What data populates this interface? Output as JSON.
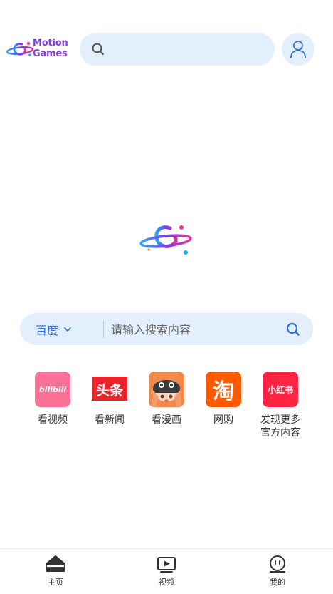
{
  "header": {
    "brand_line1": "Motion",
    "brand_line2": "Games",
    "search_placeholder": "",
    "icons": {
      "search": "search-icon",
      "profile": "user-icon"
    }
  },
  "search": {
    "engine": "百度",
    "placeholder": "请输入搜索内容",
    "value": "",
    "icons": {
      "dropdown": "chevron-down-icon",
      "go": "search-icon"
    }
  },
  "shortcuts": [
    {
      "label": "看视频",
      "tile_text": "bilibili",
      "color": "#fb7299"
    },
    {
      "label": "看新闻",
      "tile_text": "头条",
      "color": "#e8232a"
    },
    {
      "label": "看漫画",
      "tile_text": "",
      "color": "#f08a4b"
    },
    {
      "label": "网购",
      "tile_text": "淘",
      "color": "#ff5a00"
    },
    {
      "label": "发现更多\n官方内容",
      "tile_text": "小红书",
      "color": "#ff2442"
    }
  ],
  "bottom_nav": [
    {
      "label": "主页",
      "icon": "home-icon"
    },
    {
      "label": "视频",
      "icon": "video-icon"
    },
    {
      "label": "我的",
      "icon": "face-icon"
    }
  ],
  "colors": {
    "accent": "#2f6fe0",
    "search_bg": "#e3effd",
    "brand_purple": "#7c3aed",
    "brand_pink": "#e6339a",
    "brand_blue": "#2aa7f0"
  }
}
